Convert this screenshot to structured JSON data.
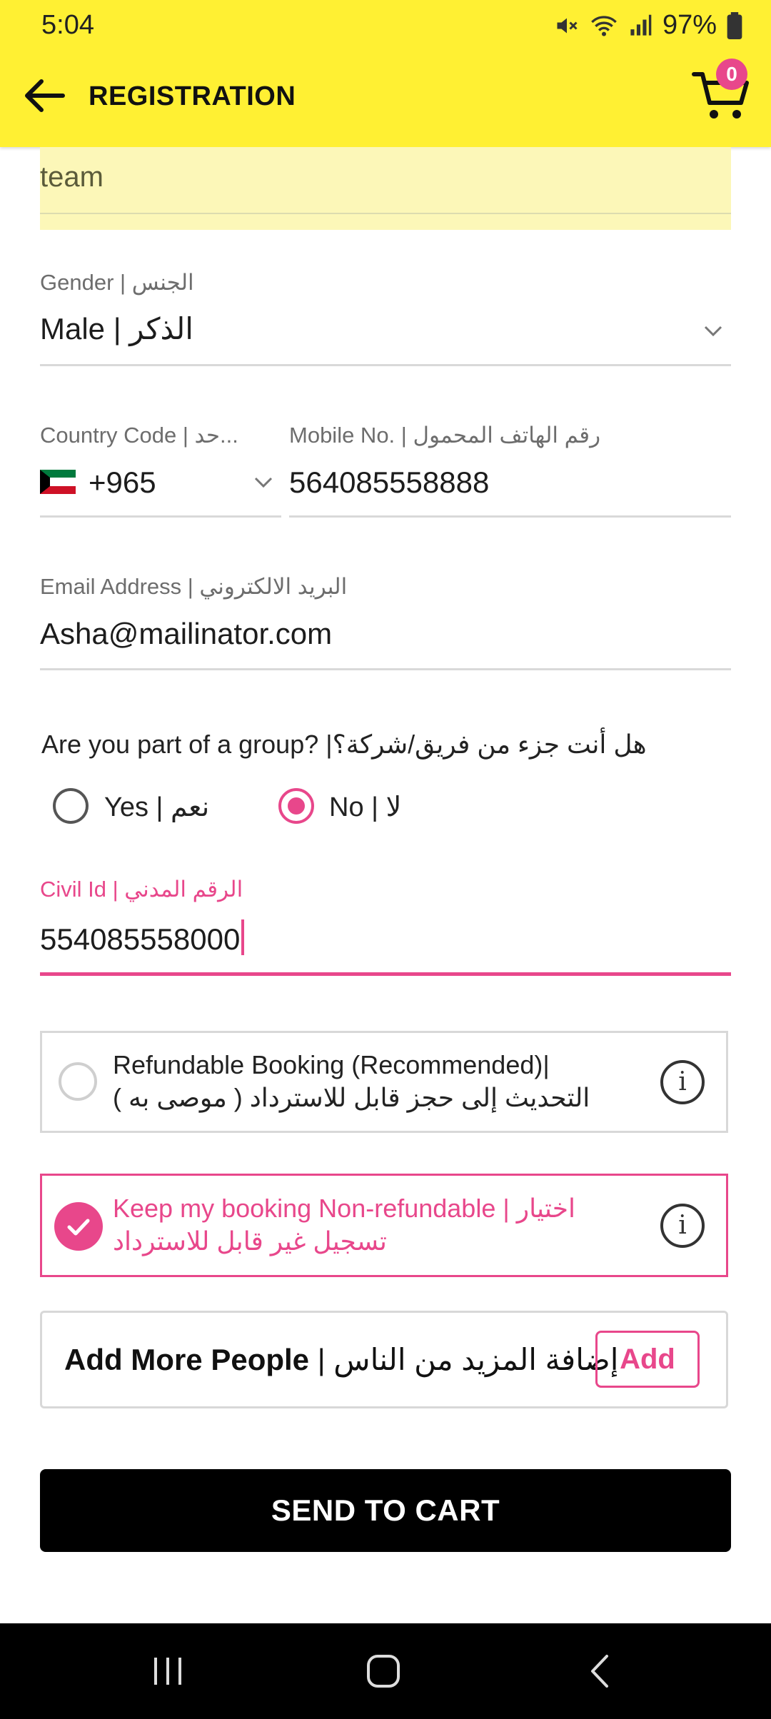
{
  "status_bar": {
    "time": "5:04",
    "battery": "97%"
  },
  "app_bar": {
    "title": "REGISTRATION",
    "cart_count": "0"
  },
  "form": {
    "team_value": "team",
    "gender": {
      "label": "Gender | الجنس",
      "value": "Male | الذكر"
    },
    "country_code": {
      "label": "Country Code | حد...",
      "value": "+965",
      "flag": "kuwait-flag"
    },
    "mobile": {
      "label": "Mobile No. | رقم الهاتف المحمول",
      "value": "564085558888"
    },
    "email": {
      "label": "Email Address  | البريد الالكتروني",
      "value": "Asha@mailinator.com"
    },
    "group_question": "Are you part of a group? |هل أنت جزء من فريق/شركة؟",
    "group_options": {
      "yes": "Yes | نعم",
      "no": "No | لا",
      "selected": "no"
    },
    "civil_id": {
      "label": "Civil Id | الرقم المدني",
      "value": "554085558000"
    }
  },
  "booking": {
    "refundable": {
      "line1": "Refundable Booking (Recommended)|",
      "line2": "التحديث إلى حجز قابل للاسترداد ( موصى به )",
      "selected": false
    },
    "non_refundable": {
      "line1": "Keep my booking Non-refundable | اختيار",
      "line2": "تسجيل غير قابل للاسترداد",
      "selected": true
    }
  },
  "add_people": {
    "label_en": "Add More People",
    "label_ar": " | إضافة المزيد من الناس",
    "button": "Add"
  },
  "send_button": "SEND TO CART",
  "colors": {
    "accent": "#E8478B",
    "header": "#FFF033"
  }
}
